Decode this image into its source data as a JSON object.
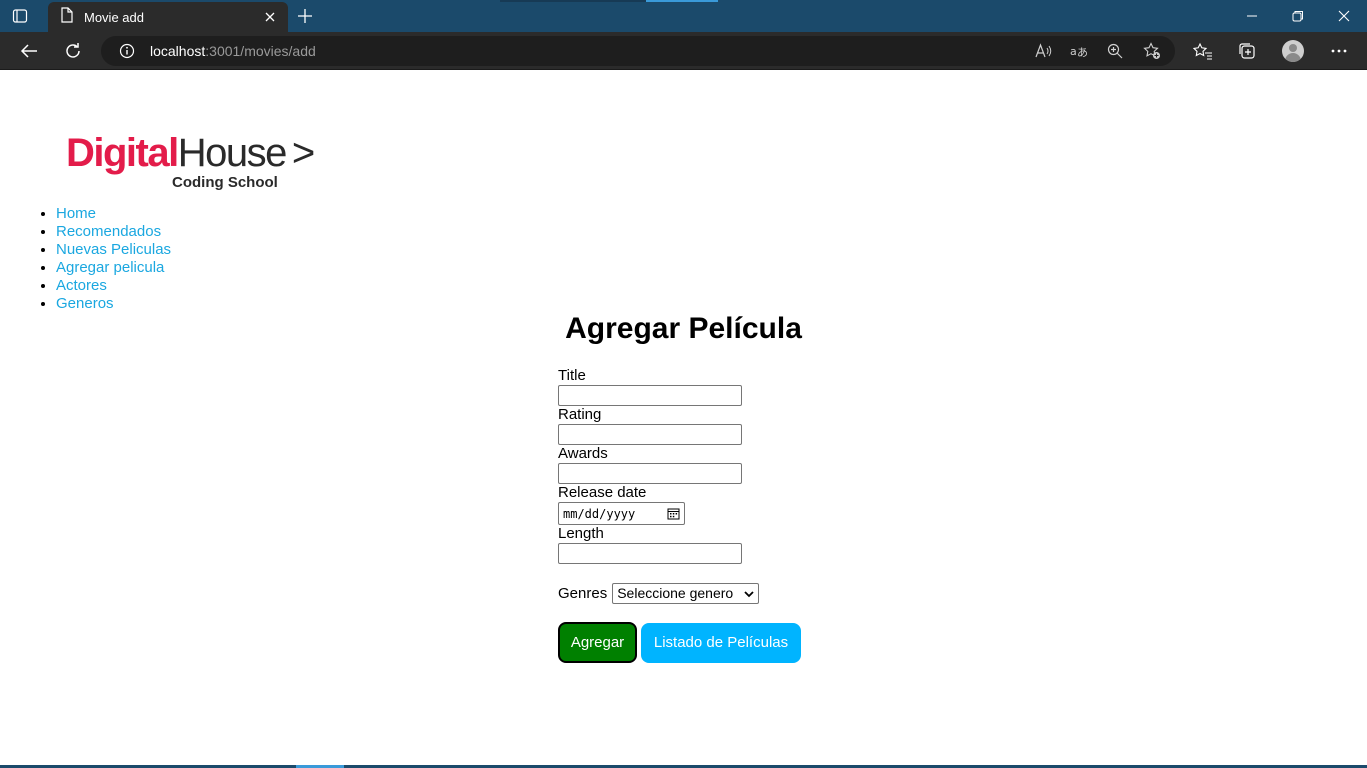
{
  "browser": {
    "tab_title": "Movie add",
    "url_host": "localhost",
    "url_path": ":3001/movies/add"
  },
  "page": {
    "logo": {
      "brand_primary": "Digital",
      "brand_secondary": "House",
      "arrow": ">",
      "tagline": "Coding School"
    },
    "nav": [
      "Home",
      "Recomendados",
      "Nuevas Peliculas",
      "Agregar pelicula",
      "Actores",
      "Generos"
    ],
    "title": "Agregar Película",
    "form": {
      "title_label": "Title",
      "rating_label": "Rating",
      "awards_label": "Awards",
      "release_label": "Release date",
      "release_placeholder": "mm/dd/yyyy",
      "length_label": "Length",
      "genres_label": "Genres",
      "genres_selected": "Seleccione genero",
      "submit_label": "Agregar",
      "list_label": "Listado de Películas"
    }
  },
  "colors": {
    "brand_red": "#e31c4a",
    "link": "#1aa7e0",
    "submit_bg": "#008000",
    "list_bg": "#00b4ff",
    "chrome_titlebar": "#1b4a6b"
  }
}
